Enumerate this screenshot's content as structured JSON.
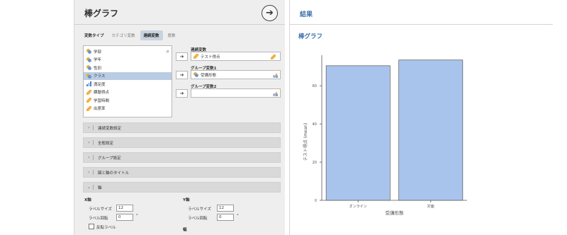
{
  "options": {
    "title": "棒グラフ",
    "go_icon": "arrow-right-circle-icon",
    "vartype_label": "変数タイプ",
    "vartype_tabs": [
      "カテゴリ変数",
      "連続変数",
      "度数"
    ],
    "vartype_active": "連続変数",
    "variables": [
      {
        "label": "学部",
        "type": "nominal"
      },
      {
        "label": "学年",
        "type": "nominal"
      },
      {
        "label": "性別",
        "type": "nominal"
      },
      {
        "label": "クラス",
        "type": "nominal",
        "selected": true
      },
      {
        "label": "満足度",
        "type": "ordinal"
      },
      {
        "label": "課題得点",
        "type": "continuous"
      },
      {
        "label": "学習時間",
        "type": "continuous"
      },
      {
        "label": "出席率",
        "type": "continuous"
      }
    ],
    "targets": {
      "continuous_label": "連続変数",
      "continuous_value": "テスト得点",
      "group1_label": "グループ変数1",
      "group1_value": "受講形態",
      "group2_label": "グループ変数2",
      "group2_value": ""
    },
    "sections": [
      "連続変数設定",
      "全般設定",
      "グループ設定",
      "図と軸のタイトル",
      "軸"
    ],
    "axis": {
      "x_head": "X軸",
      "y_head": "Y軸",
      "label_size_label": "ラベルサイズ",
      "label_rotation_label": "ラベル回転",
      "x_label_size": "12",
      "x_label_rotation": "0",
      "y_label_size": "12",
      "y_label_rotation": "0",
      "degree": "°",
      "invert_label": "反転ラベル",
      "width_label": "幅"
    }
  },
  "results": {
    "title": "結果",
    "chart_heading": "棒グラフ"
  },
  "chart_data": {
    "type": "bar",
    "categories": [
      "オンライン",
      "対面"
    ],
    "values": [
      70.5,
      73.5
    ],
    "ylabel": "テスト得点 (mean)",
    "xlabel": "受講形態",
    "ylim": [
      0,
      76
    ],
    "yticks": [
      0,
      20,
      40,
      60
    ],
    "bar_color": "#a8c4ec",
    "bar_stroke": "#555555"
  }
}
